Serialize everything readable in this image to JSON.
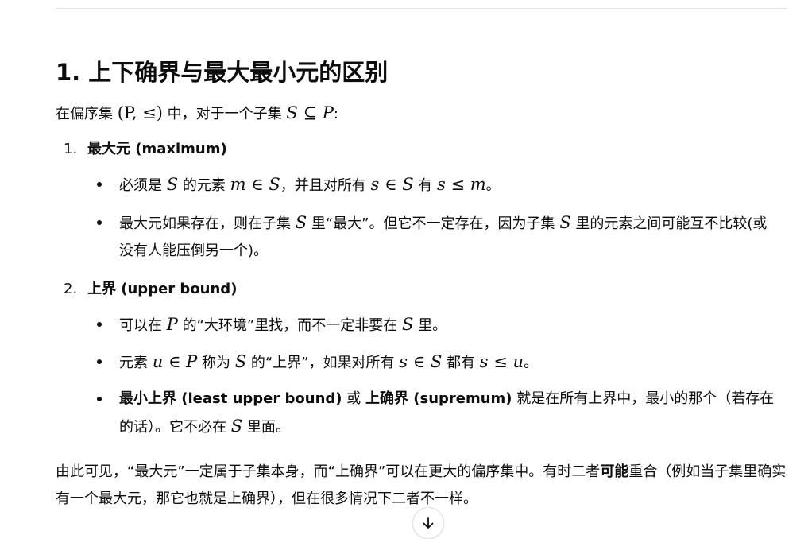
{
  "heading": "1. 上下确界与最大最小元的区别",
  "intro": {
    "pre": "在偏序集 ",
    "math1": "(P, ≤)",
    "mid": " 中，对于一个子集 ",
    "math2": "S ⊆ P",
    "post": ":"
  },
  "section1": {
    "num": "1.",
    "title": "最大元 (maximum)",
    "b1": {
      "t1": "必须是 ",
      "S1": "S",
      "t2": " 的元素 ",
      "m1": "m ∈ S",
      "t3": "，并且对所有 ",
      "m2": "s ∈ S",
      "t4": " 有 ",
      "m3": "s ≤ m",
      "t5": "。"
    },
    "b2": {
      "t1": "最大元如果存在，则在子集 ",
      "S1": "S",
      "t2": " 里“最大”。但它不一定存在，因为子集 ",
      "S2": "S",
      "t3": " 里的元素之间可能互不比较(或没有人能压倒另一个)。"
    }
  },
  "section2": {
    "num": "2.",
    "title": "上界 (upper bound)",
    "b1": {
      "t1": "可以在 ",
      "P1": "P",
      "t2": " 的“大环境”里找，而不一定非要在 ",
      "S1": "S",
      "t3": " 里。"
    },
    "b2": {
      "t1": "元素 ",
      "m1": "u ∈ P",
      "t2": " 称为 ",
      "S1": "S",
      "t3": " 的“上界”，如果对所有 ",
      "m2": "s ∈ S",
      "t4": " 都有 ",
      "m3": "s ≤ u",
      "t5": "。"
    },
    "b3": {
      "bold1": "最小上界 (least upper bound)",
      "t1": " 或 ",
      "bold2": "上确界 (supremum)",
      "t2": " 就是在所有上界中，最小的那个（若存在的话）。它不必在 ",
      "S1": "S",
      "t3": " 里面。"
    }
  },
  "conclusion": {
    "t1": "由此可见，“最大元”一定属于子集本身，而“上确界”可以在更大的偏序集中。有时二者",
    "bold": "可能",
    "t2": "重合（例如当子集里确实有一个最大元，那它也就是上确界），但在很多情况下二者不一样。"
  },
  "scroll_button": {
    "icon": "arrow-down-icon"
  }
}
